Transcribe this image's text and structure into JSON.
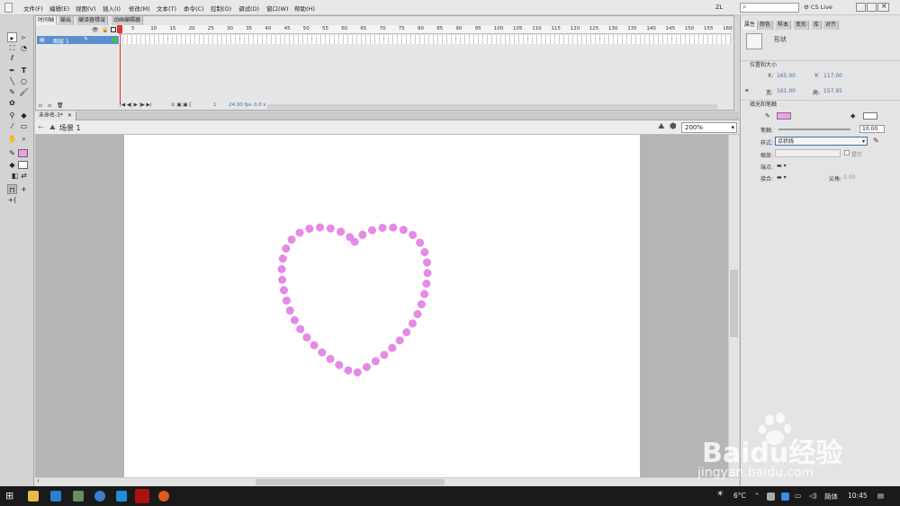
{
  "menubar": {
    "items": [
      "文件(F)",
      "编辑(E)",
      "视图(V)",
      "插入(I)",
      "修改(M)",
      "文本(T)",
      "命令(C)",
      "控制(O)",
      "调试(D)",
      "窗口(W)",
      "帮助(H)"
    ],
    "workspace": "ZL",
    "cs_live": "CS Live"
  },
  "timeline": {
    "tabs": [
      "时间轴",
      "输出",
      "编译器错误",
      "动画编辑器"
    ],
    "layer_name": "图层 1",
    "ruler_numbers": [
      "5",
      "10",
      "15",
      "20",
      "25",
      "30",
      "35",
      "40",
      "45",
      "50",
      "55",
      "60",
      "65",
      "70",
      "75",
      "80",
      "85",
      "90",
      "95",
      "100",
      "105",
      "110",
      "115",
      "120",
      "125",
      "130",
      "135",
      "140",
      "145",
      "150",
      "155",
      "160"
    ],
    "status": {
      "frame": "1",
      "fps": "24.00 fps",
      "time": "0.0 s"
    }
  },
  "document": {
    "tab_title": "未命名-3*",
    "scene": "场景 1",
    "zoom": "200%"
  },
  "properties": {
    "tabs": [
      "属性",
      "颜色",
      "样本",
      "变形",
      "库",
      "对齐"
    ],
    "object_type": "形状",
    "position_section": "位置和大小",
    "x_label": "X:",
    "x_value": "165.00",
    "y_label": "Y:",
    "y_value": "117.00",
    "w_label": "宽:",
    "w_value": "161.00",
    "h_label": "高:",
    "h_value": "157.95",
    "fill_section": "填充和笔触",
    "stroke_label": "笔触:",
    "stroke_value": "10.00",
    "style_label": "样式:",
    "style_value": "点状线",
    "scale_label": "缩放:",
    "hint_label": "提示",
    "cap_label": "端点:",
    "join_label": "接合:",
    "miter_label": "尖角:",
    "miter_value": "3.00"
  },
  "taskbar": {
    "weather": "6°C",
    "ime": "简体",
    "time": "10:45"
  },
  "watermark": {
    "brand": "Baidu经验",
    "url": "jingyan.baidu.com"
  },
  "colors": {
    "stroke": "#e58ae5",
    "fill": "#e8a0e8",
    "accent": "#3a6fb0",
    "playhead": "#dd3333"
  }
}
